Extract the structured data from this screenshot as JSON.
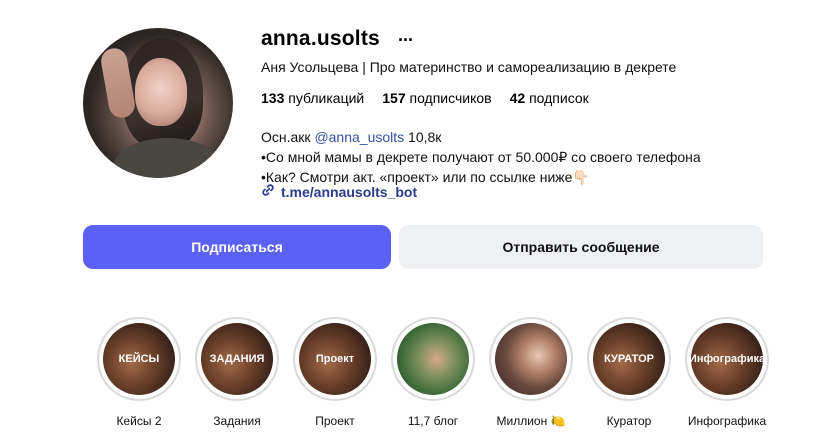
{
  "profile": {
    "username": "anna.usolts",
    "more_icon": "...",
    "full_name": "Аня Усольцева | Про материнство и самореализацию в декрете",
    "stats": {
      "posts_count": "133",
      "posts_label": "публикаций",
      "followers_count": "157",
      "followers_label": "подписчиков",
      "following_count": "42",
      "following_label": "подписок"
    },
    "bio": {
      "line1_prefix": "Осн.акк",
      "line1_mention": "@anna_usolts",
      "line1_suffix": "10,8к",
      "line2": "•Со мной мамы в декрете получают от 50.000₽ со своего телефона",
      "line3": "•Как? Смотри акт. «проект» или по ссылке ниже👇🏻"
    },
    "link": "t.me/annausolts_bot"
  },
  "buttons": {
    "follow": "Подписаться",
    "message": "Отправить сообщение"
  },
  "highlights": [
    {
      "cover_text": "КЕЙСЫ",
      "label": "Кейсы 2"
    },
    {
      "cover_text": "ЗАДАНИЯ",
      "label": "Задания"
    },
    {
      "cover_text": "Проект",
      "label": "Проект"
    },
    {
      "cover_text": "",
      "label": "11,7 блог"
    },
    {
      "cover_text": "",
      "label": "Миллион 🍋"
    },
    {
      "cover_text": "КУРАТОР",
      "label": "Куратор"
    },
    {
      "cover_text": "Инфографика",
      "label": "Инфографика"
    }
  ],
  "colors": {
    "follow_button": "#5b61f6",
    "message_button": "#eef0f3",
    "link": "#2b3a8f",
    "mention": "#3451a4"
  },
  "icons": [
    "more-icon",
    "link-icon"
  ]
}
